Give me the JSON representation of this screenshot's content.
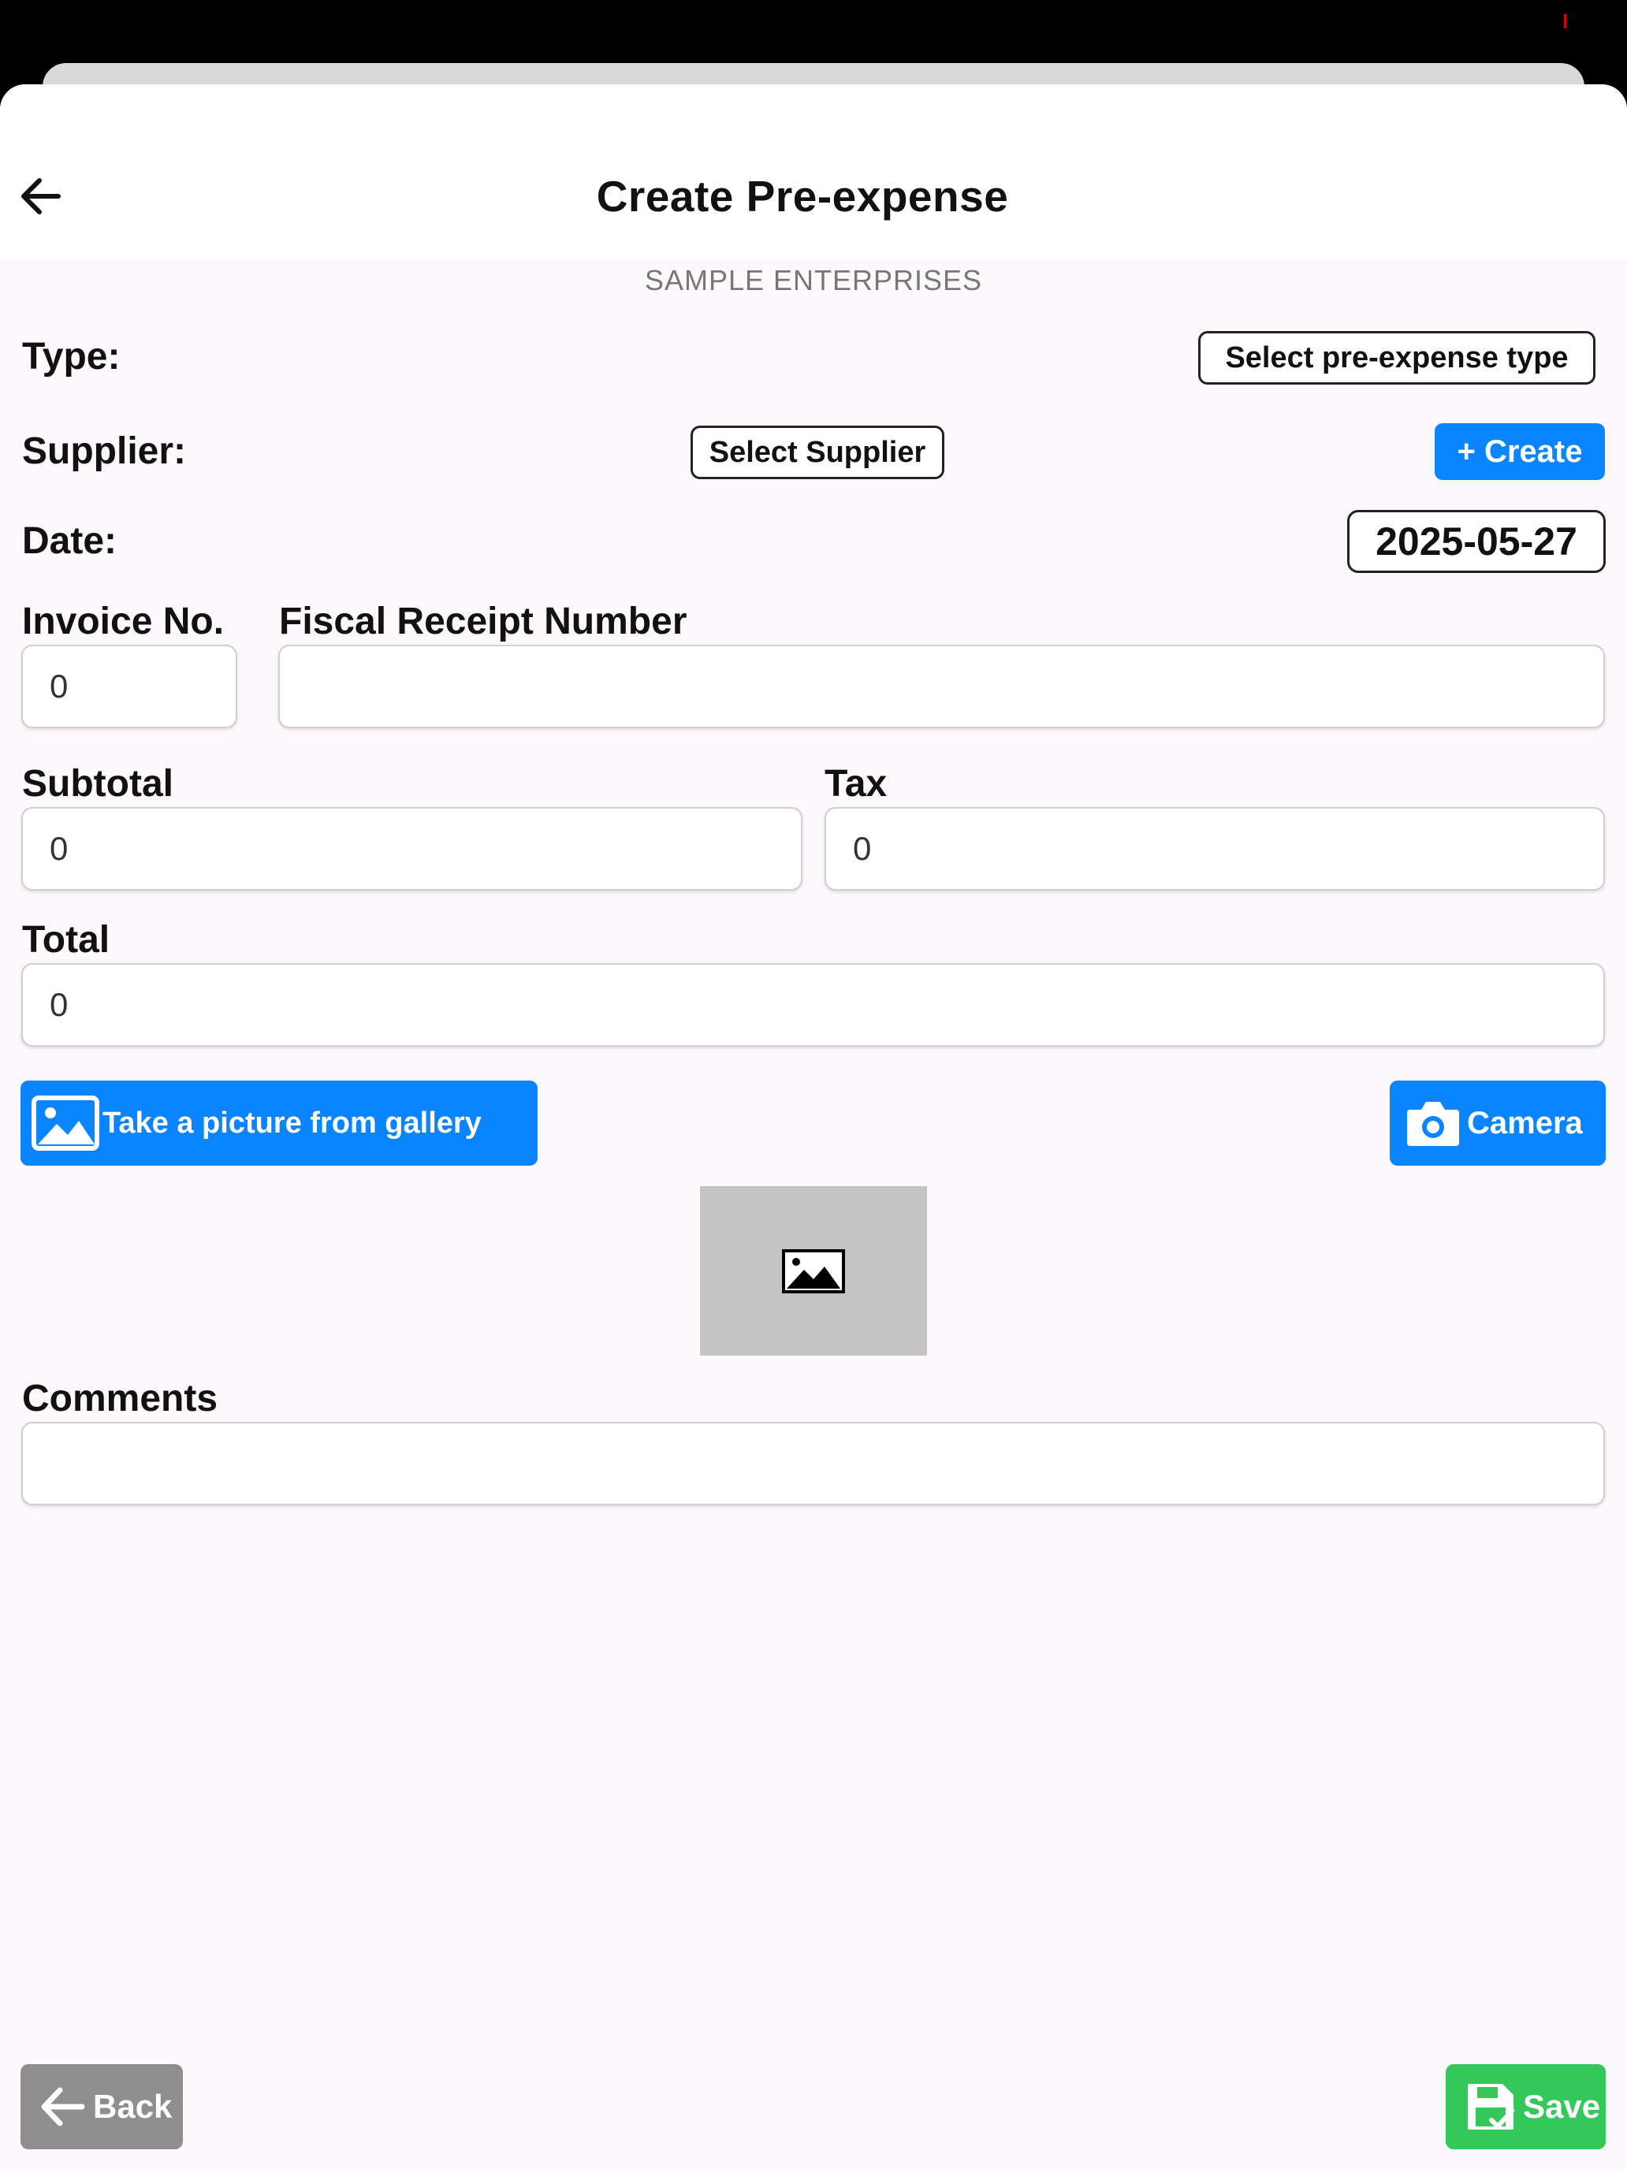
{
  "header": {
    "title": "Create Pre-expense"
  },
  "company": "SAMPLE ENTERPRISES",
  "type": {
    "label": "Type:",
    "button": "Select pre-expense type"
  },
  "supplier": {
    "label": "Supplier:",
    "button": "Select Supplier",
    "create_button": "+ Create"
  },
  "date": {
    "label": "Date:",
    "value": "2025-05-27"
  },
  "invoice": {
    "label": "Invoice No.",
    "value": "0"
  },
  "fiscal": {
    "label": "Fiscal Receipt Number",
    "value": ""
  },
  "subtotal": {
    "label": "Subtotal",
    "value": "0"
  },
  "tax": {
    "label": "Tax",
    "value": "0"
  },
  "total": {
    "label": "Total",
    "value": "0"
  },
  "gallery_button": "Take a picture from gallery",
  "camera_button": "Camera",
  "comments": {
    "label": "Comments",
    "value": ""
  },
  "footer": {
    "back_button": "Back",
    "save_button": "Save"
  },
  "colors": {
    "primary": "#0a84ff",
    "save": "#34c759",
    "back": "#8e8e8e",
    "background": "#fdf8fc"
  },
  "icons": [
    "back-arrow-icon",
    "image-icon",
    "camera-icon",
    "save-icon"
  ]
}
